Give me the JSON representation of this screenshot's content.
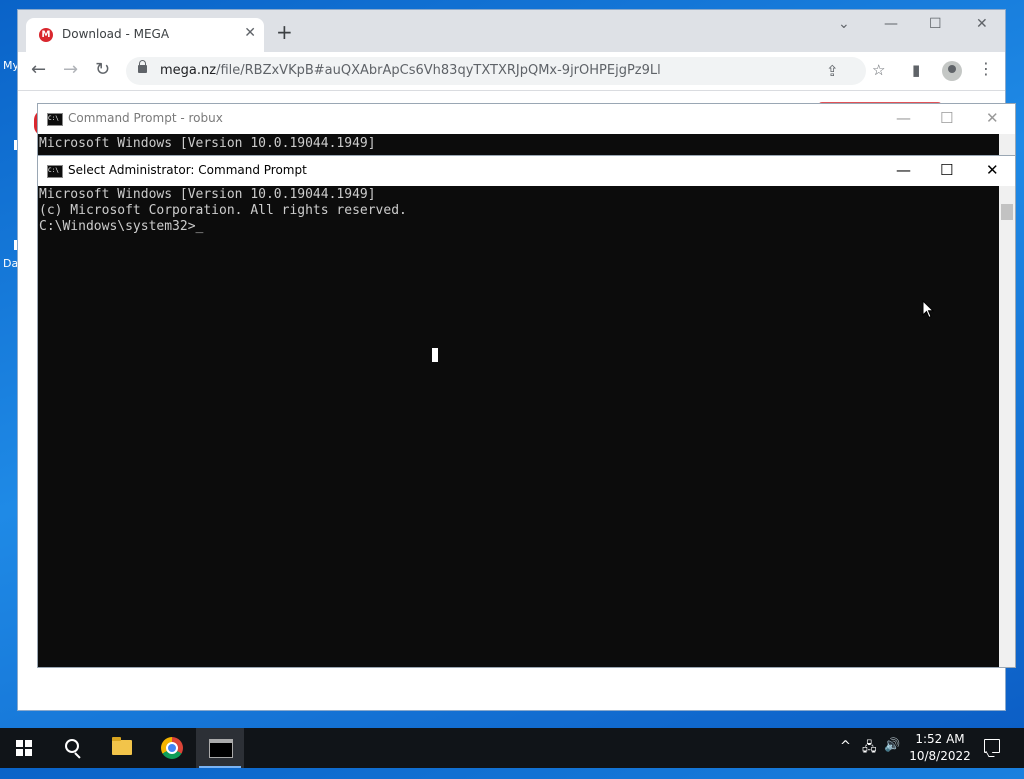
{
  "desktop": {
    "icon_label_1": "My",
    "icon_label_2": "Da"
  },
  "browser": {
    "tab": {
      "favicon_letter": "M",
      "title": "Download - MEGA",
      "close": "✕"
    },
    "new_tab": "+",
    "window_controls": {
      "tab_search": "⌄",
      "minimize": "—",
      "maximize": "☐",
      "close": "✕"
    },
    "nav": {
      "back": "←",
      "forward": "→",
      "reload": "↻"
    },
    "address": {
      "domain": "mega.nz",
      "path": "/file/RBZxVKpB#auQXAbrApCs6Vh83qyTXTXRJpQMx-9jrOHPEjgPz9Ll"
    },
    "icons": {
      "share": "⇪",
      "bookmark": "☆",
      "side_panel": "▮",
      "menu": "⋮"
    }
  },
  "console_back": {
    "title": "Command Prompt - robux",
    "icon_text": "C:\\",
    "controls": {
      "minimize": "—",
      "maximize": "☐",
      "close": "✕"
    },
    "lines": [
      "Microsoft Windows [Version 10.0.19044.1949]"
    ]
  },
  "console_front": {
    "title": "Select Administrator: Command Prompt",
    "icon_text": "C:\\",
    "controls": {
      "minimize": "—",
      "maximize": "☐",
      "close": "✕"
    },
    "lines": [
      "Microsoft Windows [Version 10.0.19044.1949]",
      "(c) Microsoft Corporation. All rights reserved.",
      "",
      "C:\\Windows\\system32>_"
    ]
  },
  "taskbar": {
    "tray_icons": {
      "chevron": "^",
      "network": "🖧",
      "volume": "🔊"
    },
    "time": "1:52 AM",
    "date": "10/8/2022"
  }
}
